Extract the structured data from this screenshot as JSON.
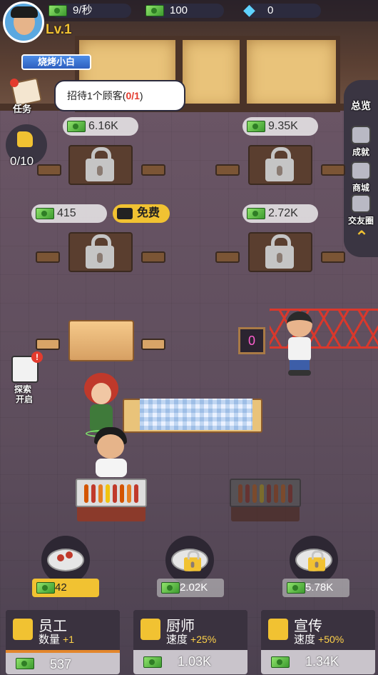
{
  "player": {
    "level": "Lv.1",
    "title": "烧烤小白"
  },
  "resources": {
    "income": "9/秒",
    "cash": "100",
    "diamonds": "0"
  },
  "task": {
    "label": "任务",
    "text_prefix": "招待1个顾客(",
    "progress": "0/1",
    "text_suffix": ")"
  },
  "likes": "0/10",
  "side_menu": {
    "overview": "总览",
    "achievements": "成就",
    "shop": "商城",
    "friends": "交友圈"
  },
  "tables": {
    "t1_price": "6.16K",
    "t2_price": "9.35K",
    "t3_price": "415",
    "t3_free": "免费",
    "t4_price": "2.72K"
  },
  "queue_sign": "0",
  "explore": {
    "label": "探索",
    "sub": "开启"
  },
  "stations": [
    {
      "price": "42"
    },
    {
      "price": "2.02K"
    },
    {
      "price": "5.78K"
    }
  ],
  "upgrades": [
    {
      "title": "员工",
      "stat": "数量",
      "bonus": "+1",
      "cost": "537"
    },
    {
      "title": "厨师",
      "stat": "速度",
      "bonus": "+25%",
      "cost": "1.03K"
    },
    {
      "title": "宣传",
      "stat": "速度",
      "bonus": "+50%",
      "cost": "1.34K"
    }
  ],
  "colors": {
    "accent_yellow": "#f1c232",
    "progress_red": "#e33b2e",
    "panel_dark": "#2c2b3e",
    "cash_green": "#4caf3a"
  },
  "icons": [
    "cash-icon",
    "diamond-icon",
    "thumb-up-icon",
    "lock-icon",
    "video-icon",
    "magnifier-icon",
    "trophy-icon",
    "shop-icon",
    "friends-icon",
    "chevron-up-icon",
    "chef-hat-icon",
    "worker-icon",
    "megaphone-icon"
  ]
}
